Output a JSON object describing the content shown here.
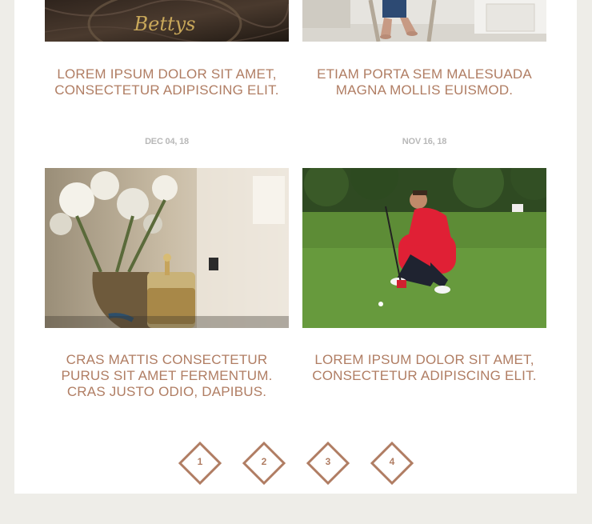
{
  "posts": [
    {
      "title": "LOREM IPSUM DOLOR SIT AMET, CONSECTETUR ADIPISCING ELIT.",
      "date": "DEC 04, 18",
      "image": "bettys-sign-photo"
    },
    {
      "title": "ETIAM PORTA SEM MALESUADA MAGNA MOLLIS EUISMOD.",
      "date": "NOV 16, 18",
      "image": "seated-person-photo"
    },
    {
      "title": "CRAS MATTIS CONSECTETUR PURUS SIT AMET FERMENTUM. CRAS JUSTO ODIO, DAPIBUS.",
      "date": "",
      "image": "french-press-flowers-photo"
    },
    {
      "title": "LOREM IPSUM DOLOR SIT AMET, CONSECTETUR ADIPISCING ELIT.",
      "date": "",
      "image": "golfer-green-photo"
    }
  ],
  "bettys_logo": "Bettys",
  "pagination": [
    "1",
    "2",
    "3",
    "4"
  ],
  "colors": {
    "accent": "#b07d63",
    "date": "#b8b8b8",
    "background": "#eeede8",
    "panel": "#ffffff"
  }
}
